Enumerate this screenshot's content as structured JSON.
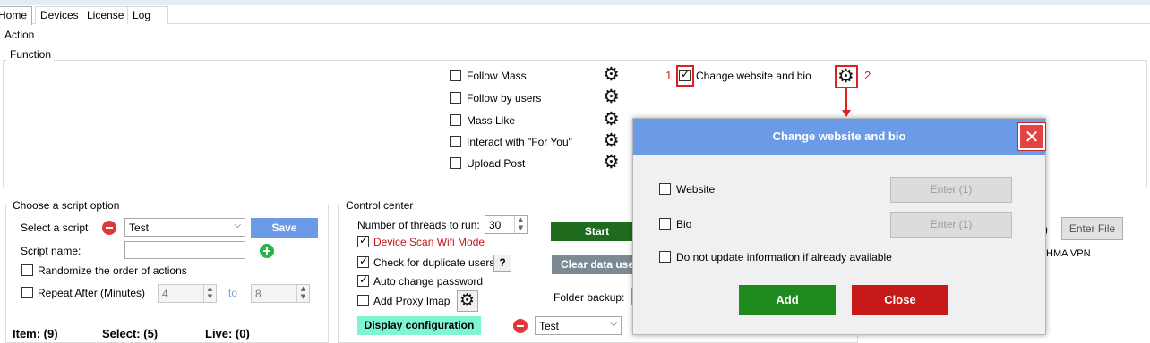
{
  "tabs": [
    "Home",
    "Devices",
    "License",
    "Log"
  ],
  "action_label": "Action",
  "function_label": "Function",
  "functions": [
    {
      "label": "Follow Mass",
      "checked": false
    },
    {
      "label": "Follow by users",
      "checked": false
    },
    {
      "label": "Mass Like",
      "checked": false
    },
    {
      "label": "Interact with \"For You\"",
      "checked": false
    },
    {
      "label": "Upload Post",
      "checked": false
    }
  ],
  "change_site": {
    "label": "Change website and bio",
    "checked": true,
    "marker1": "1",
    "marker2": "2"
  },
  "script_option": {
    "legend": "Choose a script option",
    "select_label": "Select a script",
    "select_value": "Test",
    "save_label": "Save",
    "name_label": "Script name:",
    "name_value": "",
    "randomize_label": "Randomize the order of actions",
    "repeat_label": "Repeat After (Minutes)",
    "repeat_from": "4",
    "to_label": "to",
    "repeat_to": "8"
  },
  "stats": {
    "item": "Item: (9)",
    "select": "Select: (5)",
    "live": "Live: (0)"
  },
  "control": {
    "legend": "Control center",
    "threads_label": "Number of threads to run:",
    "threads_value": "30",
    "start_label": "Start",
    "clear_label": "Clear data use",
    "device_scan_label": "Device Scan Wifi Mode",
    "check_dup_label": "Check for duplicate users",
    "help_label": "?",
    "auto_pwd_label": "Auto change password",
    "proxy_label": "Add Proxy Imap",
    "folder_label": "Folder backup:",
    "display_config_label": "Display configuration",
    "bottom_select_value": "Test"
  },
  "right_panel": {
    "paren": ")",
    "enter_file_label": "Enter File",
    "vpn_label": "HMA VPN"
  },
  "dialog": {
    "title": "Change website and bio",
    "close_glyph": "✕",
    "website_label": "Website",
    "website_enter": "Enter (1)",
    "bio_label": "Bio",
    "bio_enter": "Enter (1)",
    "no_update_label": "Do not update information if already available",
    "add_label": "Add",
    "close_label": "Close"
  },
  "icons": {
    "gear": "⚙"
  },
  "colors": {
    "save_btn": "#6b9be6",
    "start_btn": "#1e6b1e",
    "clear_btn": "#7d8a94",
    "display_btn": "#80f5d2",
    "add_btn": "#1f8a1f",
    "close_btn": "#c61919",
    "highlight": "#e02020",
    "dialog_title": "#6b9be6"
  }
}
